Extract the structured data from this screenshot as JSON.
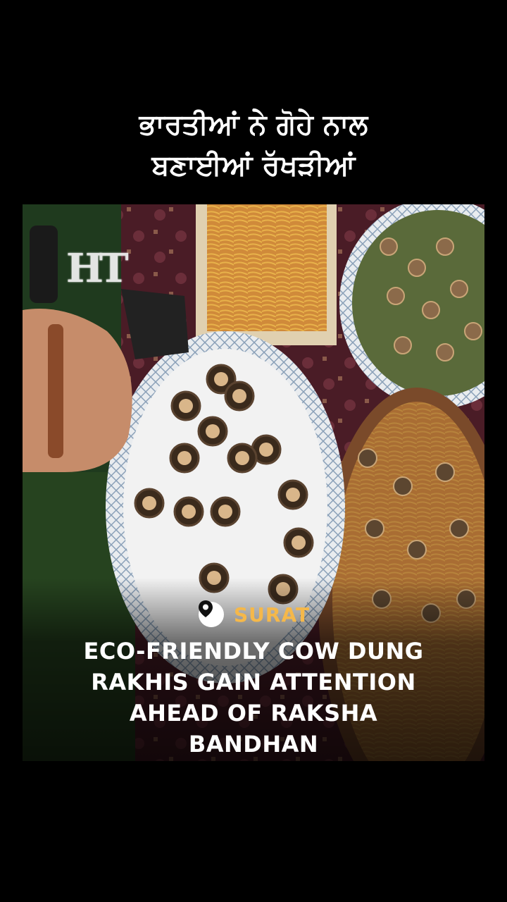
{
  "headline": {
    "line1": "ਭਾਰਤੀਆਂ ਨੇ ਗੋਹੇ ਨਾਲ",
    "line2": "ਬਣਾਈਆਂ ਰੱਖੜੀਆਂ"
  },
  "video": {
    "logo": "HT",
    "location": {
      "icon": "location-pin-icon",
      "text": "SURAT"
    },
    "story_lines": [
      "ECO-FRIENDLY COW DUNG",
      "RAKHIS GAIN ATTENTION",
      "AHEAD OF RAKSHA",
      "BANDHAN"
    ]
  },
  "colors": {
    "background": "#000000",
    "location_accent": "#f5b84a",
    "headline_text": "#ffffff"
  }
}
